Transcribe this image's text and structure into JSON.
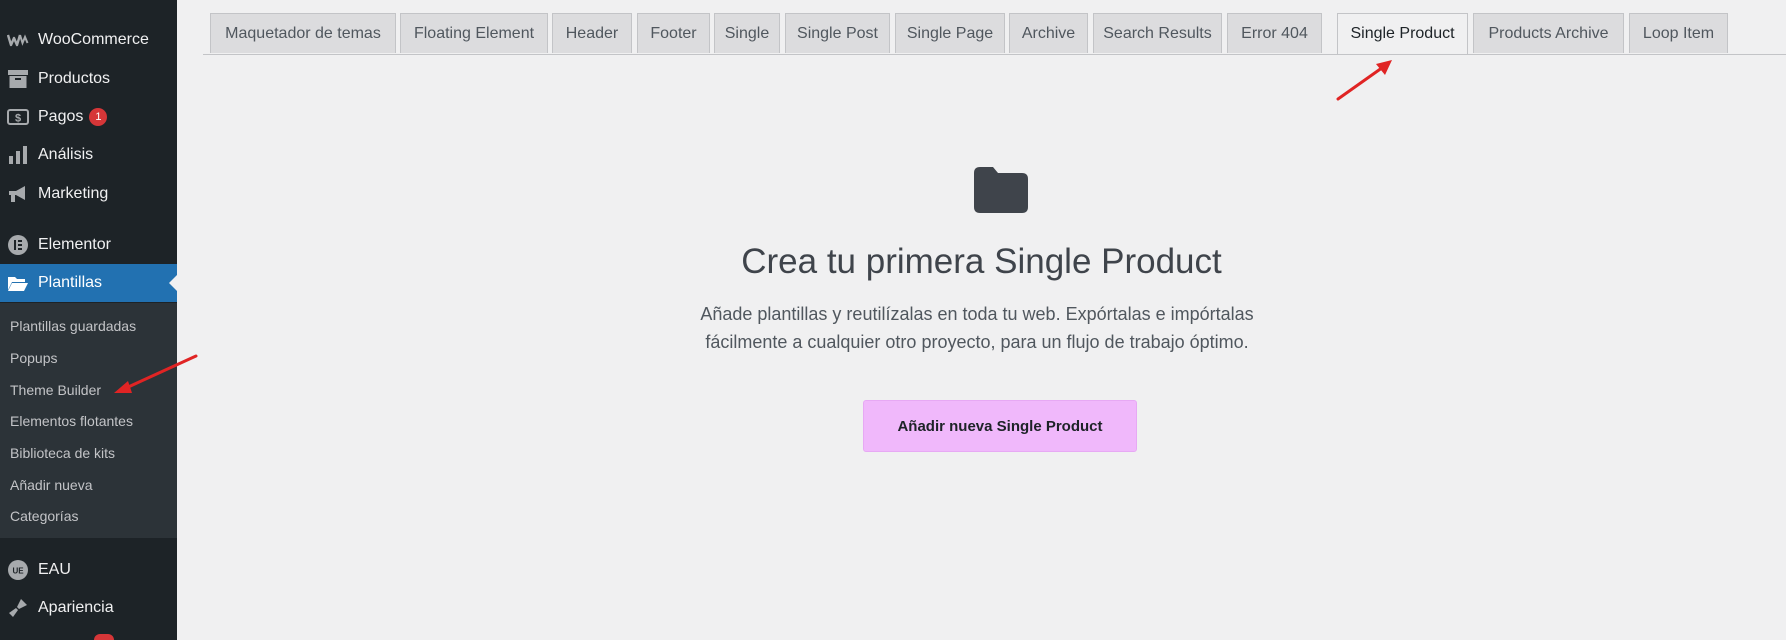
{
  "sidebar": {
    "menu": [
      {
        "label": "WooCommerce",
        "icon": "woocommerce-icon"
      },
      {
        "label": "Productos",
        "icon": "archive-icon"
      },
      {
        "label": "Pagos",
        "icon": "money-icon",
        "badge": "1"
      },
      {
        "label": "Análisis",
        "icon": "bar-chart-icon"
      },
      {
        "label": "Marketing",
        "icon": "megaphone-icon"
      },
      {
        "label": "Elementor",
        "icon": "elementor-icon"
      },
      {
        "label": "Plantillas",
        "icon": "folder-open-icon",
        "active": true
      },
      {
        "label": "EAU",
        "icon": "eau-icon"
      },
      {
        "label": "Apariencia",
        "icon": "paintbrush-icon"
      }
    ],
    "submenu": [
      "Plantillas guardadas",
      "Popups",
      "Theme Builder",
      "Elementos flotantes",
      "Biblioteca de kits",
      "Añadir nueva",
      "Categorías"
    ]
  },
  "tabs": [
    "Maquetador de temas",
    "Floating Element",
    "Header",
    "Footer",
    "Single",
    "Single Post",
    "Single Page",
    "Archive",
    "Search Results",
    "Error 404",
    "Single Product",
    "Products Archive",
    "Loop Item"
  ],
  "active_tab": "Single Product",
  "empty_state": {
    "icon": "folder-icon",
    "title": "Crea tu primera Single Product",
    "description": "Añade plantillas y reutilízalas en toda tu web. Expórtalas e impórtalas fácilmente a cualquier otro proyecto, para un flujo de trabajo óptimo.",
    "button": "Añadir nueva Single Product"
  },
  "colors": {
    "sidebar_bg": "#1d2327",
    "active_menu": "#2271b1",
    "button_bg": "#f0b8fb",
    "badge": "#d63638",
    "annotation_arrow": "#e02424"
  }
}
